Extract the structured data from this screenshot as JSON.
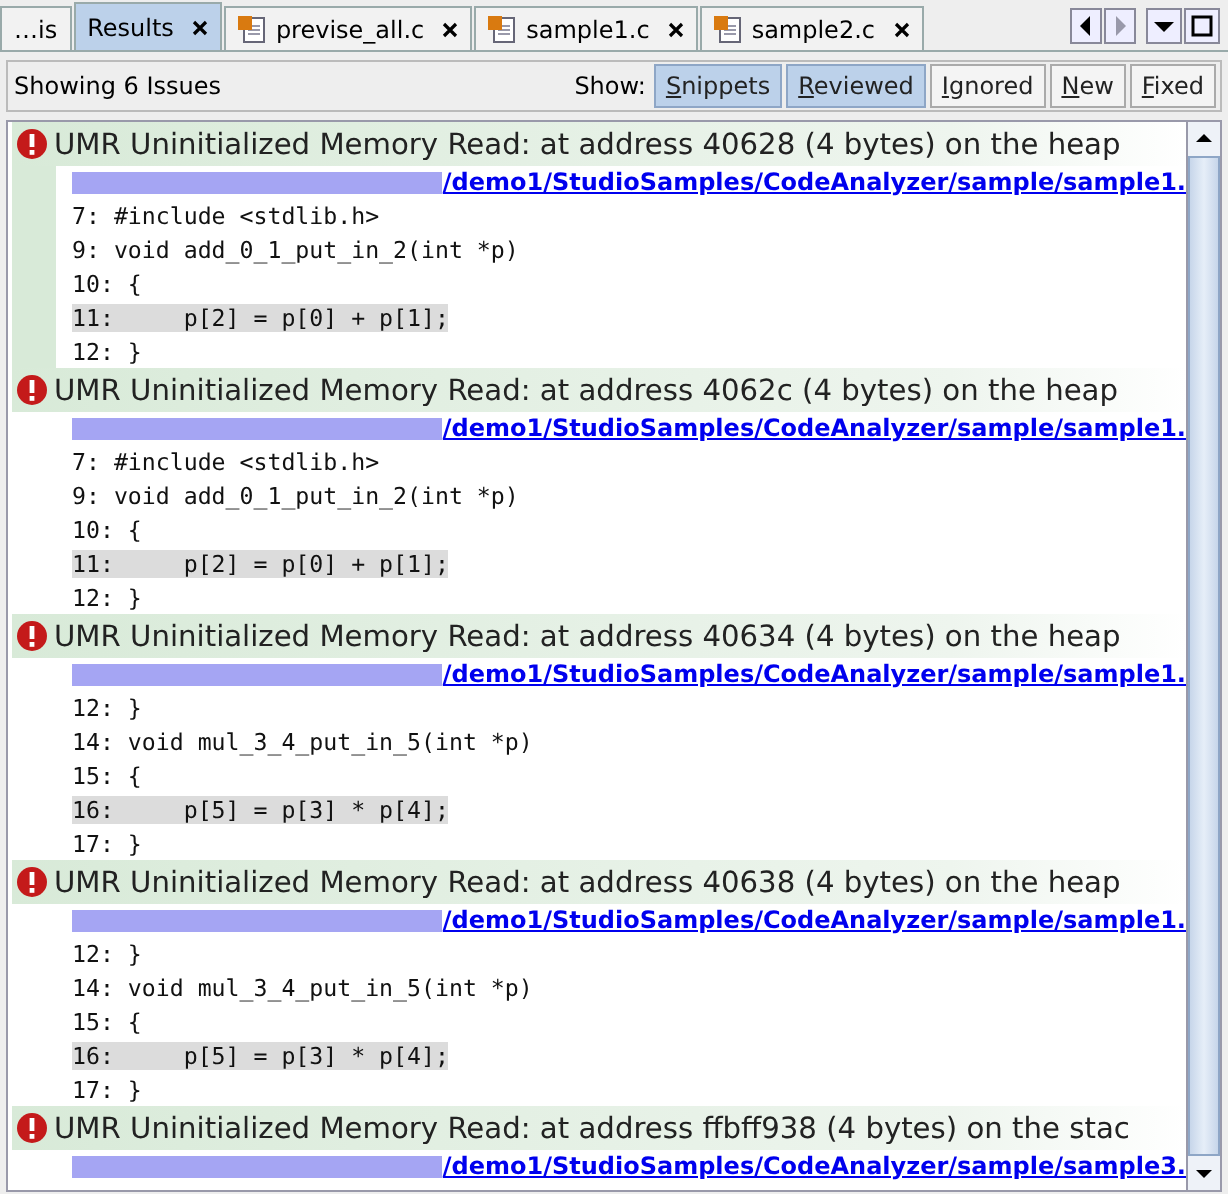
{
  "tabs": [
    {
      "label": "…is",
      "kind": "truncated",
      "selected": false
    },
    {
      "label": "Results",
      "kind": "plain",
      "selected": true
    },
    {
      "label": "previse_all.c",
      "kind": "file",
      "selected": false
    },
    {
      "label": "sample1.c",
      "kind": "file",
      "selected": false
    },
    {
      "label": "sample2.c",
      "kind": "file",
      "selected": false
    }
  ],
  "toolbar": {
    "status": "Showing 6 Issues",
    "show_label": "Show:",
    "filters": [
      {
        "label": "Snippets",
        "selected": true
      },
      {
        "label": "Reviewed",
        "selected": true
      },
      {
        "label": "Ignored",
        "selected": false
      },
      {
        "label": "New",
        "selected": false
      },
      {
        "label": "Fixed",
        "selected": false
      }
    ]
  },
  "issues": [
    {
      "title": "UMR Uninitialized Memory Read: at address 40628 (4 bytes) on the heap",
      "path": "/demo1/StudioSamples/CodeAnalyzer/sample/sample1.",
      "selected": true,
      "lines": [
        {
          "text": "7: #include <stdlib.h>",
          "highlighted": false
        },
        {
          "text": "9: void add_0_1_put_in_2(int *p)",
          "highlighted": false
        },
        {
          "text": "10: {",
          "highlighted": false
        },
        {
          "text": "11:     p[2] = p[0] + p[1];",
          "highlighted": true
        },
        {
          "text": "12: }",
          "highlighted": false
        }
      ]
    },
    {
      "title": "UMR Uninitialized Memory Read: at address 4062c (4 bytes) on the heap",
      "path": "/demo1/StudioSamples/CodeAnalyzer/sample/sample1.",
      "selected": false,
      "lines": [
        {
          "text": "7: #include <stdlib.h>",
          "highlighted": false
        },
        {
          "text": "9: void add_0_1_put_in_2(int *p)",
          "highlighted": false
        },
        {
          "text": "10: {",
          "highlighted": false
        },
        {
          "text": "11:     p[2] = p[0] + p[1];",
          "highlighted": true
        },
        {
          "text": "12: }",
          "highlighted": false
        }
      ]
    },
    {
      "title": "UMR Uninitialized Memory Read: at address 40634 (4 bytes) on the heap",
      "path": "/demo1/StudioSamples/CodeAnalyzer/sample/sample1.",
      "selected": false,
      "lines": [
        {
          "text": "12: }",
          "highlighted": false
        },
        {
          "text": "14: void mul_3_4_put_in_5(int *p)",
          "highlighted": false
        },
        {
          "text": "15: {",
          "highlighted": false
        },
        {
          "text": "16:     p[5] = p[3] * p[4];",
          "highlighted": true
        },
        {
          "text": "17: }",
          "highlighted": false
        }
      ]
    },
    {
      "title": "UMR Uninitialized Memory Read: at address 40638 (4 bytes) on the heap",
      "path": "/demo1/StudioSamples/CodeAnalyzer/sample/sample1.",
      "selected": false,
      "lines": [
        {
          "text": "12: }",
          "highlighted": false
        },
        {
          "text": "14: void mul_3_4_put_in_5(int *p)",
          "highlighted": false
        },
        {
          "text": "15: {",
          "highlighted": false
        },
        {
          "text": "16:     p[5] = p[3] * p[4];",
          "highlighted": true
        },
        {
          "text": "17: }",
          "highlighted": false
        }
      ]
    },
    {
      "title": "UMR Uninitialized Memory Read: at address ffbff938 (4 bytes) on the stac",
      "path": "/demo1/StudioSamples/CodeAnalyzer/sample/sample3.",
      "selected": false
    }
  ]
}
